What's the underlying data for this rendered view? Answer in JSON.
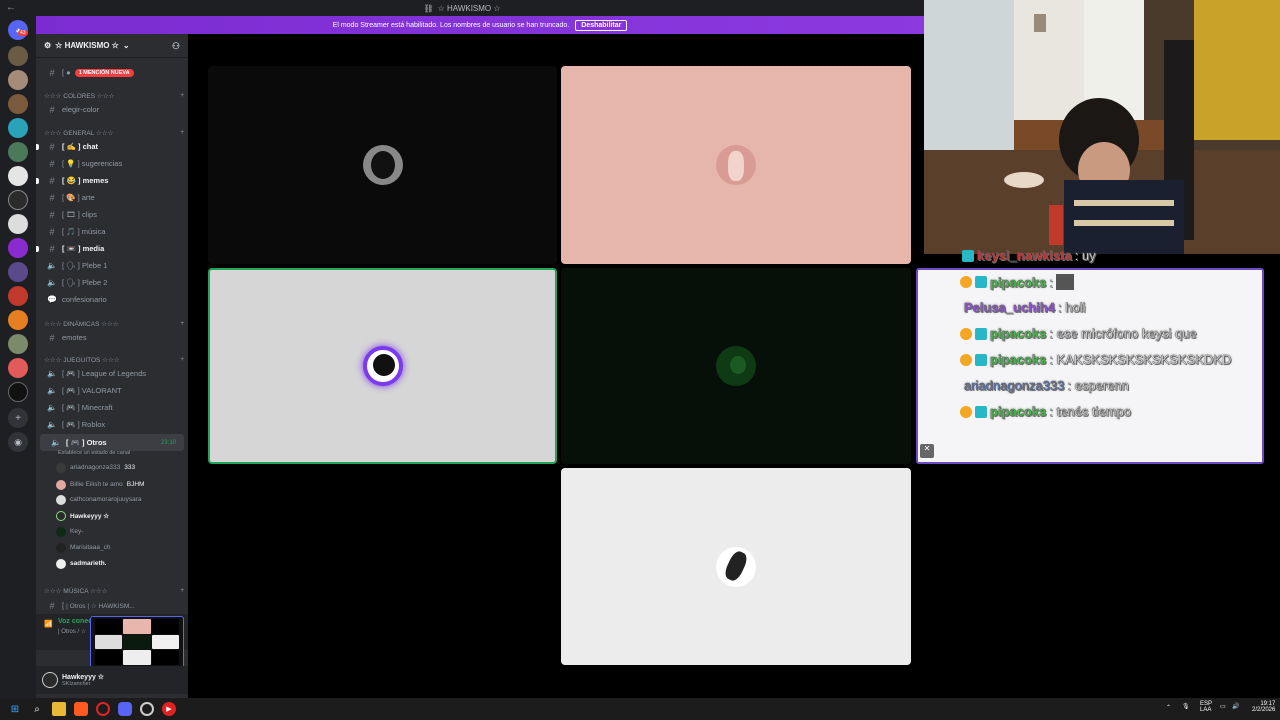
{
  "window": {
    "title": "☆ HAWKISMO ☆"
  },
  "streamer_banner": {
    "text": "El modo Streamer está habilitado. Los nombres de usuario se han truncado.",
    "button": "Deshabilitar"
  },
  "rail": {
    "notification_count": "43"
  },
  "guild": {
    "name": "☆ HAWKISMO ☆"
  },
  "mention_badge": "1 MENCIÓN NUEVA",
  "categories": {
    "colores": "☆☆☆ COLORES ☆☆☆",
    "general": "☆☆☆ GENERAL ☆☆☆",
    "dinamicas": "☆☆☆ DINÁMICAS ☆☆☆",
    "jueguitos": "☆☆☆ JUEGUITOS ☆☆☆",
    "musica": "☆☆☆ MÚSICA ☆☆☆"
  },
  "channels": {
    "elegir_color": "elegir-color",
    "chat": "chat",
    "sugerencias": "sugerencias",
    "memes": "memes",
    "arte": "arte",
    "clips": "clips",
    "musica": "música",
    "media": "media",
    "plebe1": "Plebe 1",
    "plebe2": "Plebe 2",
    "confesionario": "confesionario",
    "emotes": "emotes",
    "lol": "League of Legends",
    "valorant": "VALORANT",
    "minecraft": "Minecraft",
    "roblox": "Roblox",
    "otros": "Otros",
    "otros_status": "Establece un estado de canal",
    "otros_timer": "23:10",
    "music_vc": "| Otros | ☆ HAWKISM..."
  },
  "voice_users": [
    {
      "name": "ariadnagonza333",
      "tag": "333"
    },
    {
      "name": "Billie Eilish te amo",
      "tag": "BJHM"
    },
    {
      "name": "cathconamorarojuuysara",
      "tag": ""
    },
    {
      "name": "Hawkeyyy ☆",
      "tag": ""
    },
    {
      "name": "Key-",
      "tag": ""
    },
    {
      "name": "Marisitaaa_ch",
      "tag": ""
    },
    {
      "name": "sadmarieth.",
      "tag": ""
    }
  ],
  "voice_connected": {
    "label": "Voz conecta",
    "sub": "| Otros / ☆"
  },
  "self_user": {
    "name": "Hawkeyyy ☆",
    "status": "SKIzancher"
  },
  "chat_overlay": [
    {
      "user": "keysi_nawkista",
      "text": ": uy",
      "color": "#e02222"
    },
    {
      "user": "pipacoks",
      "text": ": ",
      "color": "#32d235"
    },
    {
      "user": "Pelusa_uchih4",
      "text": ": holi",
      "color": "#9b4bf0"
    },
    {
      "user": "pipacoks",
      "text": ": ese micrófono keysi que",
      "color": "#32d235"
    },
    {
      "user": "pipacoks",
      "text": ": KAKSKSKSKSKSKSKSKDKD",
      "color": "#32d235"
    },
    {
      "user": "ariadnagonza333",
      "text": ": esperenn",
      "color": "#4a73d9"
    },
    {
      "user": "pipacoks",
      "text": ": tenés tiempo",
      "color": "#32d235"
    }
  ],
  "taskbar": {
    "lang": "ESP",
    "lang2": "LAA",
    "time": "19:17",
    "date": "2/2/2026"
  }
}
